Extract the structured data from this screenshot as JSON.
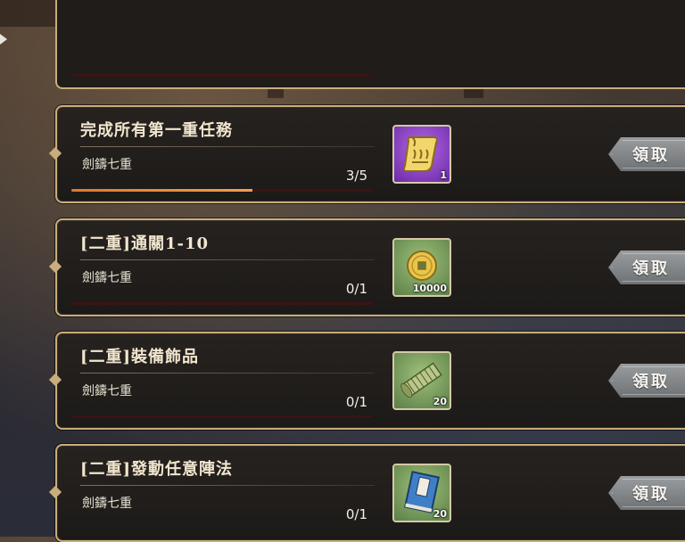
{
  "tasks": [
    {
      "title": "完成所有第一重任務",
      "category": "劍鑄七重",
      "progress": "3/5",
      "progress_fraction": 0.6,
      "reward_icon": "scroll-icon",
      "reward_count": "1",
      "button": "領取"
    },
    {
      "title": "[二重]通關1-10",
      "category": "劍鑄七重",
      "progress": "0/1",
      "progress_fraction": 0,
      "reward_icon": "coin-icon",
      "reward_count": "10000",
      "button": "領取"
    },
    {
      "title": "[二重]裝備飾品",
      "category": "劍鑄七重",
      "progress": "0/1",
      "progress_fraction": 0,
      "reward_icon": "bamboo-scroll-icon",
      "reward_count": "20",
      "button": "領取"
    },
    {
      "title": "[二重]發動任意陣法",
      "category": "劍鑄七重",
      "progress": "0/1",
      "progress_fraction": 0,
      "reward_icon": "book-icon",
      "reward_count": "20",
      "button": "領取"
    }
  ],
  "colors": {
    "accent_gold": "#c9ad7c",
    "progress": "#e0782e",
    "reward_rare": "#8a3fc4",
    "reward_common": "#7fa35e"
  }
}
